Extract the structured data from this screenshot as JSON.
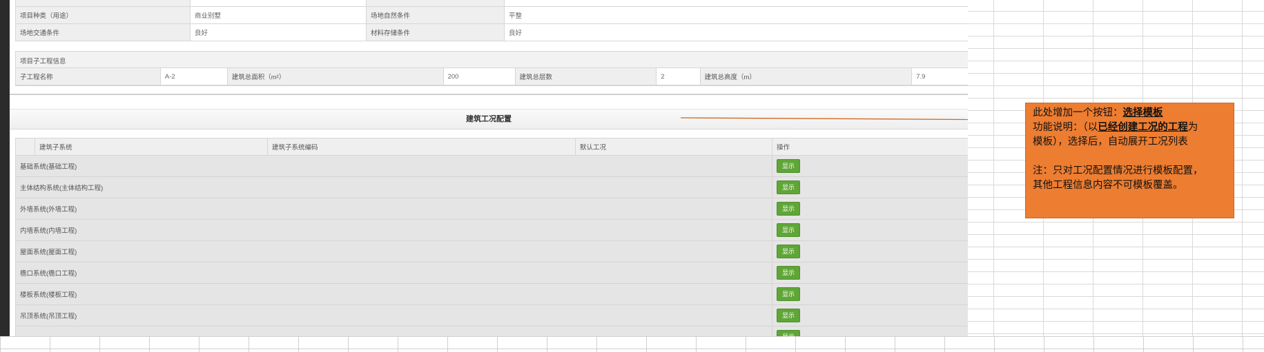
{
  "project_info": {
    "rows": [
      {
        "l1": "项目种类（用途）",
        "v1": "商业别墅",
        "l2": "场地自然条件",
        "v2": "平整"
      },
      {
        "l1": "场地交通条件",
        "v1": "良好",
        "l2": "材料存储条件",
        "v2": "良好"
      }
    ]
  },
  "sub_project": {
    "header": "项目子工程信息",
    "name_label": "子工程名称",
    "name_value": "A-2",
    "area_label": "建筑总面积（m²）",
    "area_value": "200",
    "floors_label": "建筑总层数",
    "floors_value": "2",
    "height_label": "建筑总高度（m）",
    "height_value": "7.9"
  },
  "config": {
    "title": "建筑工况配置",
    "columns": [
      "建筑子系统",
      "建筑子系统编码",
      "默认工况",
      "操作"
    ],
    "button_label": "显示",
    "rows": [
      "基础系统(基础工程)",
      "主体结构系统(主体结构工程)",
      "外墙系统(外墙工程)",
      "内墙系统(内墙工程)",
      "屋面系统(屋面工程)",
      "檐口系统(檐口工程)",
      "楼板系统(楼板工程)",
      "吊顶系统(吊顶工程)",
      ""
    ]
  },
  "note": {
    "line1_prefix": "此处增加一个按钮：",
    "line1_bold": "选择模板",
    "line2_prefix": "功能说明：（以",
    "line2_bold": "已经创建工况的工程",
    "line2_suffix": "为",
    "line3": "模板），选择后，自动展开工况列表",
    "line4": "注：只对工况配置情况进行模板配置，",
    "line5": "其他工程信息内容不可模板覆盖。"
  },
  "colors": {
    "note_bg": "#ed7d31",
    "button": "#5fa637",
    "arrow": "#d2691e"
  }
}
